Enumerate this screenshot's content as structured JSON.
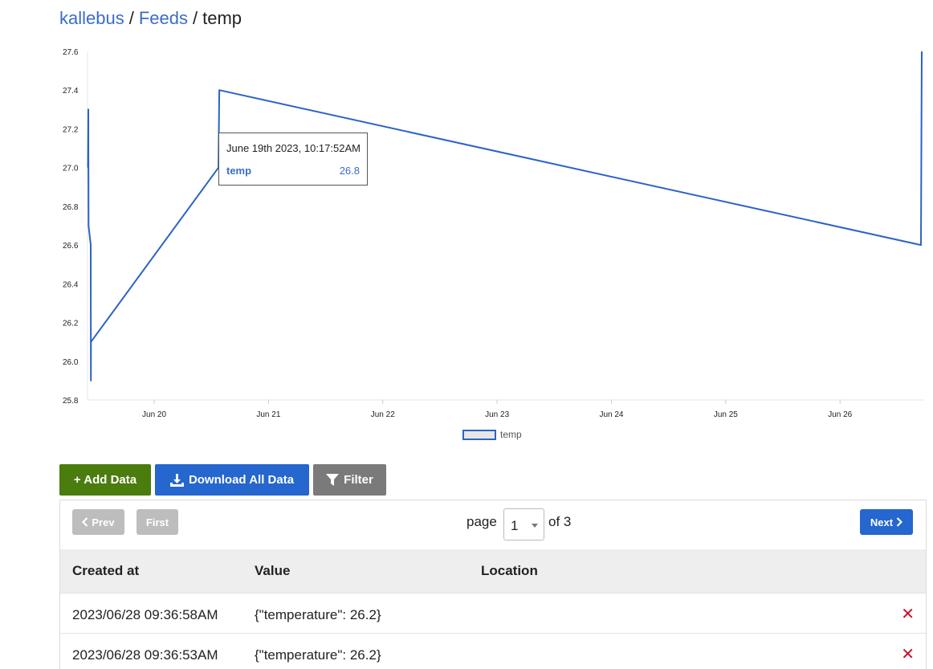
{
  "breadcrumb": {
    "user": "kallebus",
    "section": "Feeds",
    "current": "temp",
    "separator": "/"
  },
  "chart_data": {
    "type": "line",
    "title": "",
    "xlabel": "",
    "ylabel": "",
    "ylim": [
      25.8,
      27.6
    ],
    "xlim": [
      "2023-06-19T10:00:00",
      "2023-06-26T17:40:00"
    ],
    "y_ticks": [
      "27.6",
      "27.4",
      "27.2",
      "27.0",
      "26.8",
      "26.6",
      "26.4",
      "26.2",
      "26.0",
      "25.8"
    ],
    "x_ticks": [
      {
        "label": "Jun 20",
        "x": "2023-06-20T00:00:00"
      },
      {
        "label": "Jun 21",
        "x": "2023-06-21T00:00:00"
      },
      {
        "label": "Jun 22",
        "x": "2023-06-22T00:00:00"
      },
      {
        "label": "Jun 23",
        "x": "2023-06-23T00:00:00"
      },
      {
        "label": "Jun 24",
        "x": "2023-06-24T00:00:00"
      },
      {
        "label": "Jun 25",
        "x": "2023-06-25T00:00:00"
      },
      {
        "label": "Jun 26",
        "x": "2023-06-26T00:00:00"
      }
    ],
    "grid": false,
    "legend": "bottom",
    "series": [
      {
        "name": "temp",
        "color": "#2b63c6",
        "points": [
          {
            "x": "2023-06-19T10:05:00",
            "y": 27.0
          },
          {
            "x": "2023-06-19T10:10:00",
            "y": 27.3
          },
          {
            "x": "2023-06-19T10:13:00",
            "y": 26.7
          },
          {
            "x": "2023-06-19T10:40:00",
            "y": 26.6
          },
          {
            "x": "2023-06-19T10:42:00",
            "y": 25.9
          },
          {
            "x": "2023-06-19T10:44:00",
            "y": 26.1
          },
          {
            "x": "2023-06-20T13:30:00",
            "y": 27.0
          },
          {
            "x": "2023-06-20T13:40:00",
            "y": 27.4
          },
          {
            "x": "2023-06-26T17:00:00",
            "y": 26.6
          },
          {
            "x": "2023-06-26T17:10:00",
            "y": 27.6
          }
        ]
      }
    ],
    "tooltip": {
      "date": "June 19th 2023, 10:17:52AM",
      "series": "temp",
      "value": "26.8"
    }
  },
  "toolbar": {
    "add_label": "+ Add Data",
    "download_label": "Download All Data",
    "filter_label": "Filter"
  },
  "pagination": {
    "prev_label": "Prev",
    "first_label": "First",
    "next_label": "Next",
    "page_label": "page",
    "page_value": "1",
    "of_label": "of 3"
  },
  "table": {
    "headers": [
      "Created at",
      "Value",
      "Location"
    ],
    "rows": [
      {
        "created_at": "2023/06/28 09:36:58AM",
        "value": "{\"temperature\": 26.2}",
        "location": ""
      },
      {
        "created_at": "2023/06/28 09:36:53AM",
        "value": "{\"temperature\": 26.2}",
        "location": ""
      }
    ]
  },
  "colors": {
    "link": "#3a6cc9",
    "add": "#4a7c0e",
    "primary": "#2566cf",
    "filter": "#7a7a7a",
    "disabled": "#bdbdbd",
    "delete": "#c8102e"
  }
}
